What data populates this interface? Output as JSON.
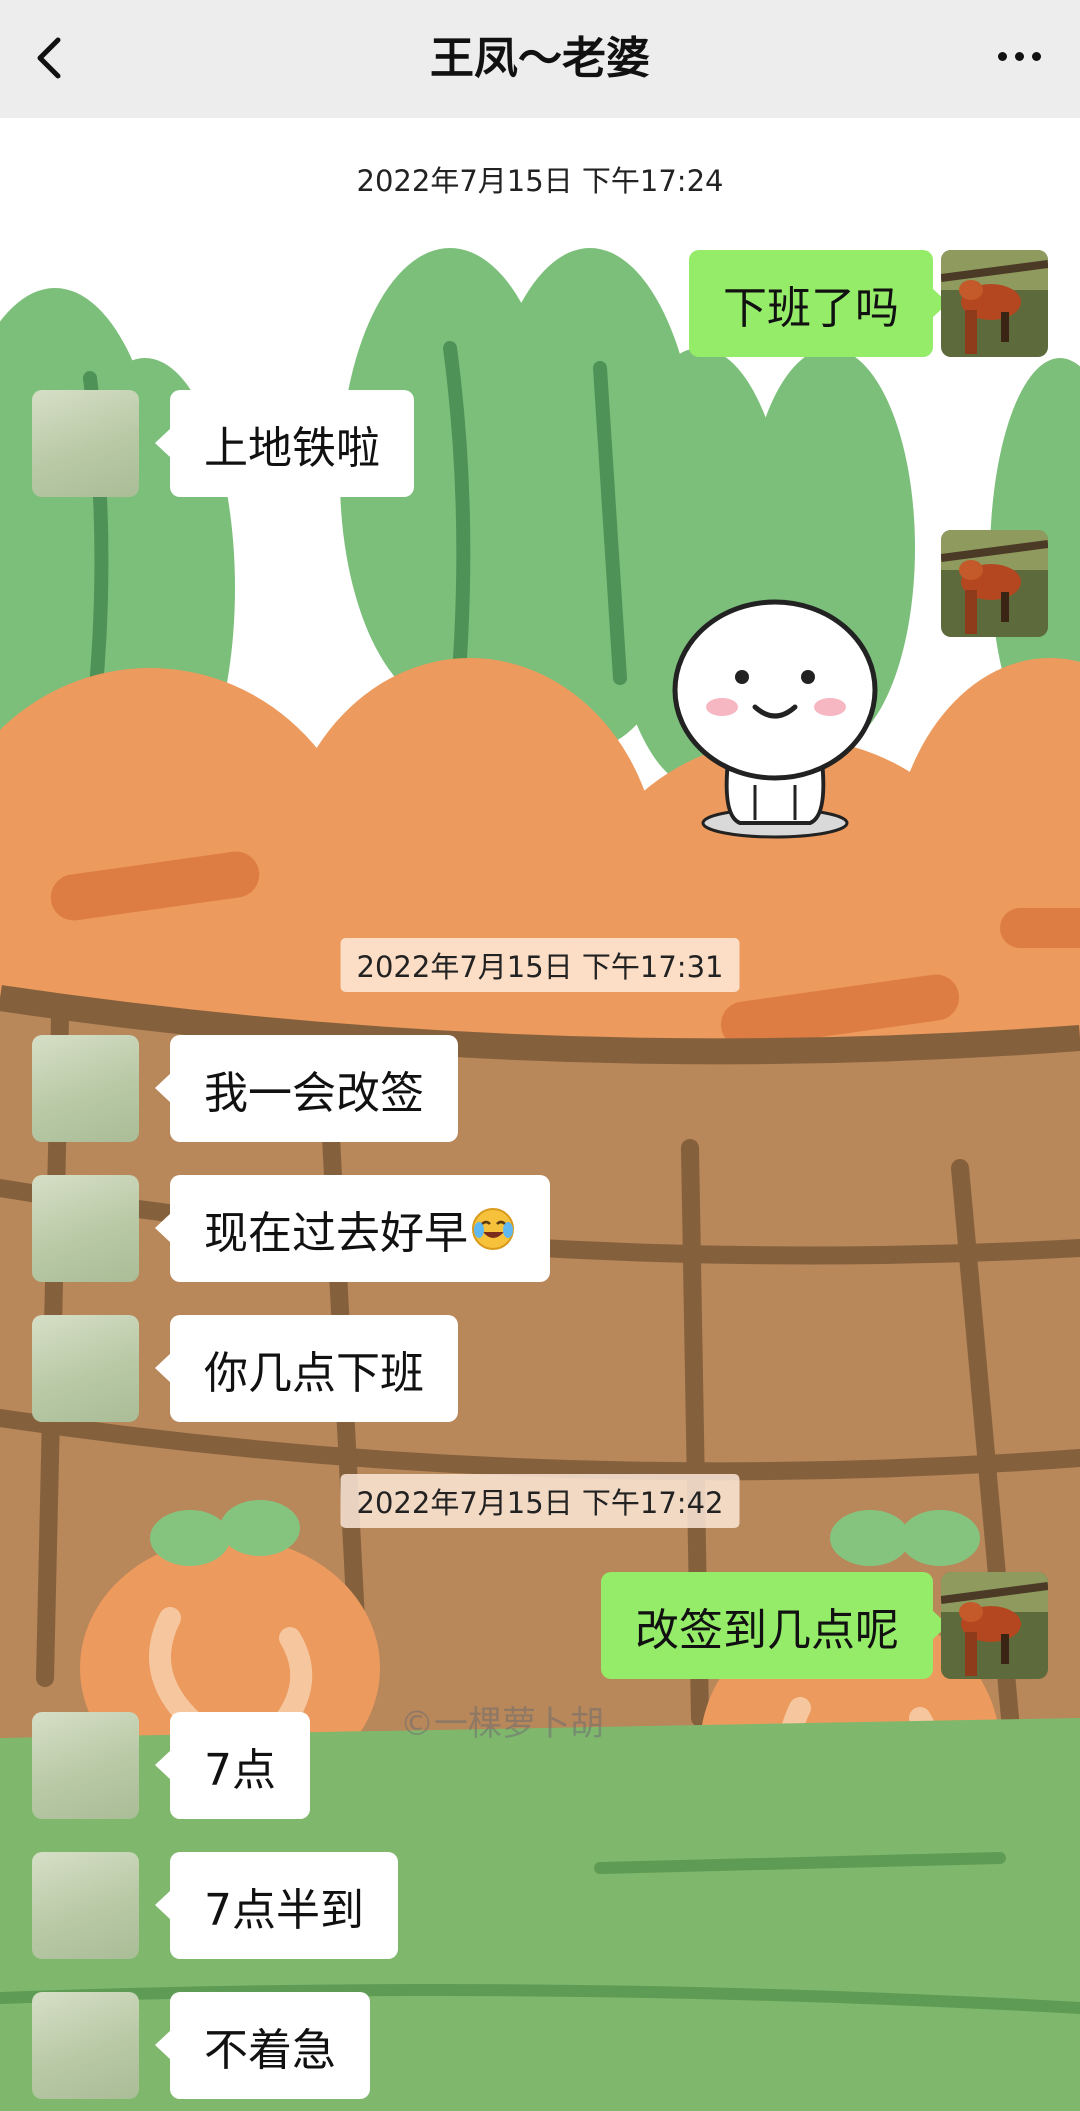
{
  "header": {
    "title": "王凤～老婆",
    "back_icon": "chevron-left-icon",
    "more_icon": "more-dots-icon"
  },
  "timestamps": [
    "2022年7月15日 下午17:24",
    "2022年7月15日 下午17:31",
    "2022年7月15日 下午17:42"
  ],
  "messages": [
    {
      "side": "out",
      "text": "下班了吗"
    },
    {
      "side": "in",
      "text": "上地铁啦"
    },
    {
      "side": "out",
      "type": "sticker",
      "sticker": "smiling-dumpling-sticker"
    },
    {
      "side": "in",
      "text": "我一会改签"
    },
    {
      "side": "in",
      "text": "现在过去好早",
      "emoji": "laughing-crying-emoji"
    },
    {
      "side": "in",
      "text": "你几点下班"
    },
    {
      "side": "out",
      "text": "改签到几点呢"
    },
    {
      "side": "in",
      "text": "7点"
    },
    {
      "side": "in",
      "text": "7点半到"
    },
    {
      "side": "in",
      "text": "不着急"
    }
  ],
  "background": {
    "description_icon": "carrot-basket-wallpaper",
    "watermark": "©一棵萝卜胡"
  },
  "colors": {
    "header_bg": "#ededed",
    "outgoing_bubble": "#95ec69",
    "incoming_bubble": "#ffffff",
    "carrot_orange": "#ec9a5d",
    "leaf_green": "#6aac6a",
    "basket_brown": "#b8875a"
  }
}
